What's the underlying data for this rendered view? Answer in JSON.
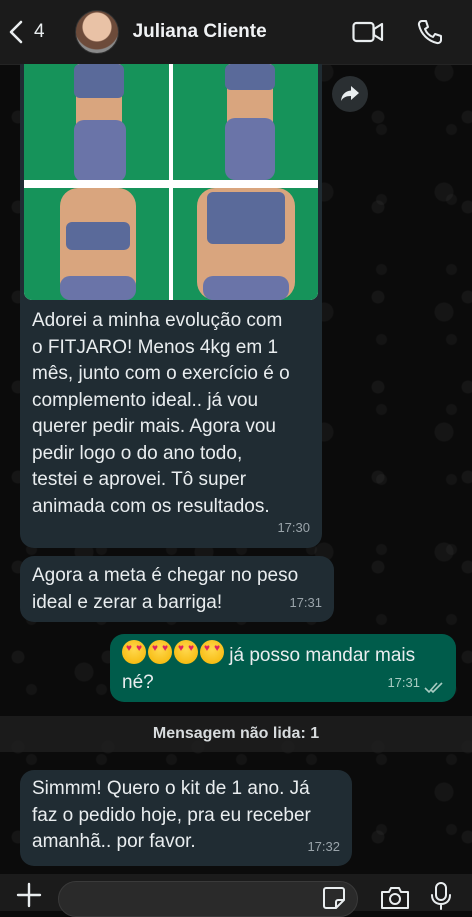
{
  "header": {
    "back_count": "4",
    "contact_name": "Juliana Cliente"
  },
  "messages": [
    {
      "direction": "incoming",
      "has_photo": true,
      "text": "Adorei a minha evolução com\no FITJARO! Menos 4kg em 1\nmês, junto com o exercício é o\ncomplemento ideal.. já vou\nquerer pedir mais. Agora vou\npedir logo o do ano todo,\ntestei e aprovei. Tô super\nanimada com os resultados.",
      "time": "17:30"
    },
    {
      "direction": "incoming",
      "text": "Agora a meta é chegar no peso\nideal e zerar a barriga!",
      "time": "17:31"
    },
    {
      "direction": "outgoing",
      "emoji_count": 4,
      "text_line1": "já posso mandar mais",
      "text_line2": "né?",
      "time": "17:31",
      "status": "read"
    },
    {
      "direction": "incoming",
      "text": "Simmm! Quero o kit de 1 ano. Já\nfaz o pedido hoje, pra eu receber\namanhã.. por favor.",
      "time": "17:32"
    }
  ],
  "unread_divider": "Mensagem não lida: 1",
  "colors": {
    "incoming_bubble": "#202c33",
    "outgoing_bubble": "#005c4b",
    "header": "#1b1b1b",
    "photo_background": "#16935a"
  },
  "icons": {
    "header": [
      "back-chevron-icon",
      "video-call-icon",
      "phone-icon"
    ],
    "chat": [
      "forward-icon",
      "double-check-icon"
    ],
    "composer": [
      "plus-icon",
      "sticker-icon",
      "camera-icon",
      "microphone-icon"
    ]
  }
}
